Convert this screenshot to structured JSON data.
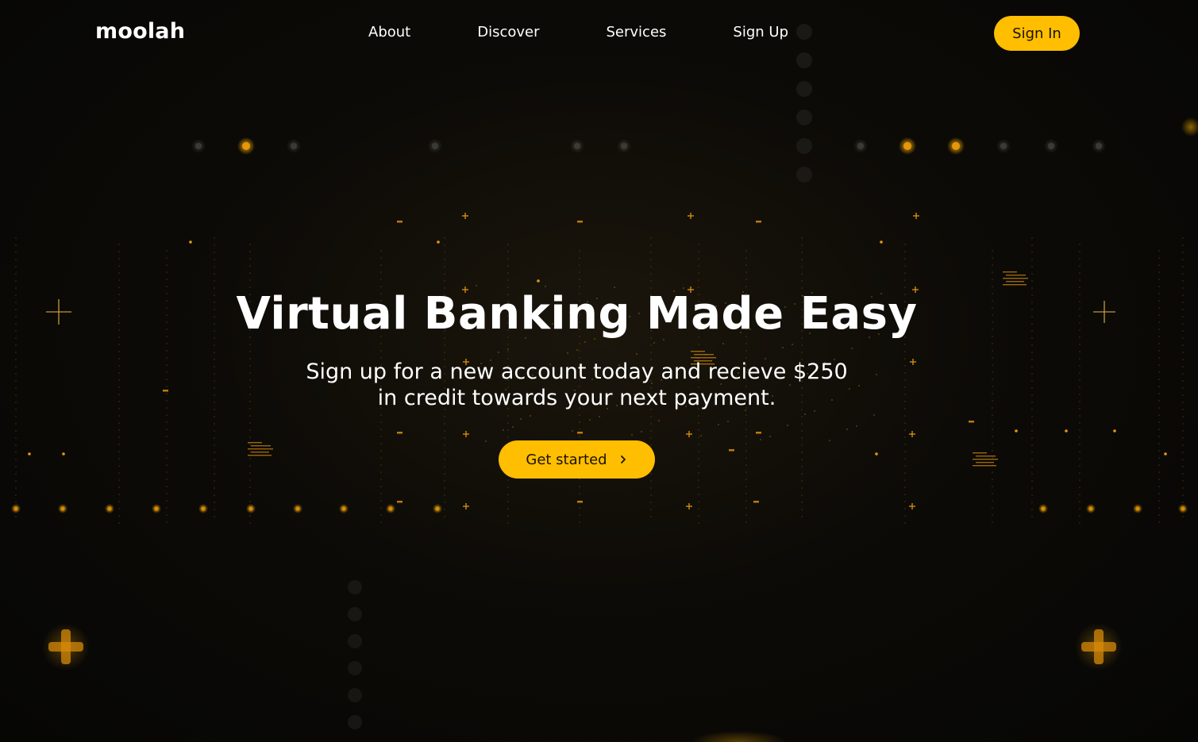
{
  "brand": {
    "logo_text": "moolah"
  },
  "nav": {
    "items": [
      {
        "label": "About"
      },
      {
        "label": "Discover"
      },
      {
        "label": "Services"
      },
      {
        "label": "Sign Up"
      }
    ],
    "signin_label": "Sign In"
  },
  "hero": {
    "title": "Virtual Banking Made Easy",
    "subtitle_line1": "Sign up for a new account today and recieve $250",
    "subtitle_line2": "in credit towards your next payment.",
    "cta_label": "Get started",
    "cta_icon": "chevron-right-icon"
  },
  "colors": {
    "accent": "#ffbe00",
    "background": "#0a0a08",
    "text": "#ffffff"
  }
}
